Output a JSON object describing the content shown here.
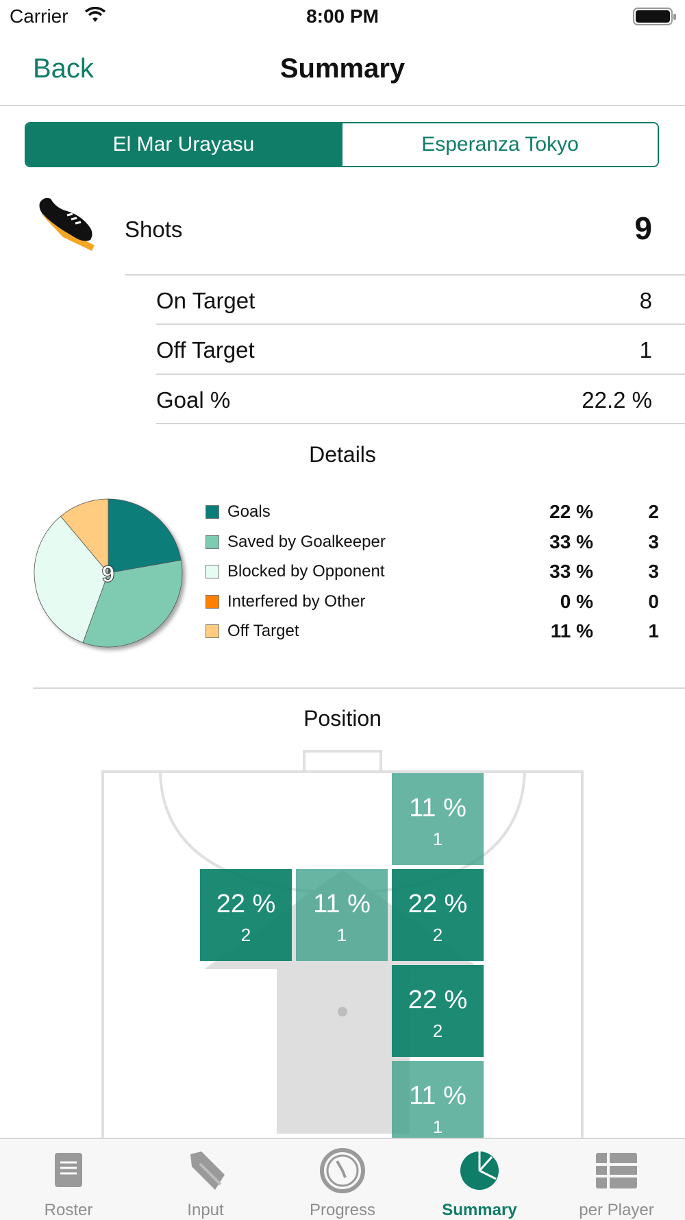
{
  "status_bar": {
    "carrier": "Carrier",
    "time": "8:00 PM"
  },
  "nav": {
    "back_label": "Back",
    "title": "Summary"
  },
  "segments": {
    "selected": "El Mar Urayasu",
    "other": "Esperanza Tokyo"
  },
  "shots": {
    "label": "Shots",
    "value": "9",
    "rows": [
      {
        "label": "On Target",
        "value": "8"
      },
      {
        "label": "Off Target",
        "value": "1"
      },
      {
        "label": "Goal %",
        "value": "22.2 %"
      }
    ]
  },
  "details": {
    "title": "Details",
    "center_label": "9",
    "legend": [
      {
        "label": "Goals",
        "pct": "22 %",
        "count": "2",
        "color": "#0a7d7a"
      },
      {
        "label": "Saved by Goalkeeper",
        "pct": "33 %",
        "count": "3",
        "color": "#7fcbb1"
      },
      {
        "label": "Blocked by Opponent",
        "pct": "33 %",
        "count": "3",
        "color": "#e6fbf1"
      },
      {
        "label": "Interfered by Other",
        "pct": "0 %",
        "count": "0",
        "color": "#ff8000"
      },
      {
        "label": "Off Target",
        "pct": "11 %",
        "count": "1",
        "color": "#ffcc80"
      }
    ]
  },
  "chart_data": {
    "type": "pie",
    "categories": [
      "Goals",
      "Saved by Goalkeeper",
      "Blocked by Opponent",
      "Interfered by Other",
      "Off Target"
    ],
    "values": [
      2,
      3,
      3,
      0,
      1
    ],
    "colors": [
      "#0a7d7a",
      "#7fcbb1",
      "#e6fbf1",
      "#ff8000",
      "#ffcc80"
    ]
  },
  "position": {
    "title": "Position",
    "cells": [
      {
        "pct": "11 %",
        "count": "1",
        "shade": "light"
      },
      {
        "pct": "22 %",
        "count": "2",
        "shade": "dark"
      },
      {
        "pct": "11 %",
        "count": "1",
        "shade": "light"
      },
      {
        "pct": "22 %",
        "count": "2",
        "shade": "dark"
      },
      {
        "pct": "22 %",
        "count": "2",
        "shade": "dark"
      },
      {
        "pct": "11 %",
        "count": "1",
        "shade": "light"
      }
    ]
  },
  "tabs": [
    {
      "label": "Roster",
      "icon": "roster-icon"
    },
    {
      "label": "Input",
      "icon": "pen-icon"
    },
    {
      "label": "Progress",
      "icon": "clock-icon"
    },
    {
      "label": "Summary",
      "icon": "pie-icon"
    },
    {
      "label": "per Player",
      "icon": "list-icon"
    }
  ],
  "colors": {
    "accent": "#0f7d68"
  }
}
